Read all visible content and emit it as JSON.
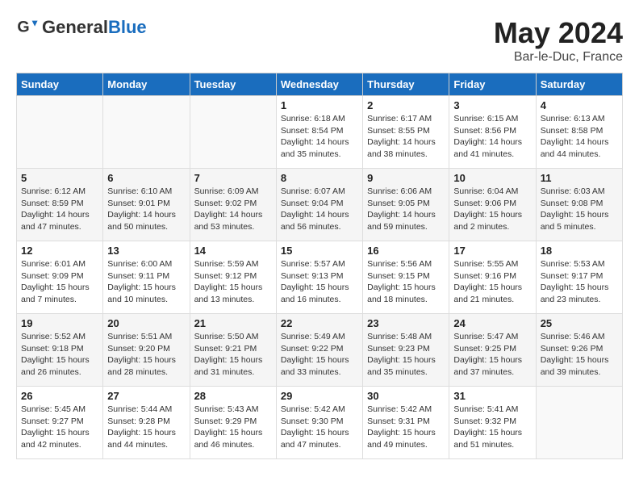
{
  "header": {
    "logo_general": "General",
    "logo_blue": "Blue",
    "month": "May 2024",
    "location": "Bar-le-Duc, France"
  },
  "days_of_week": [
    "Sunday",
    "Monday",
    "Tuesday",
    "Wednesday",
    "Thursday",
    "Friday",
    "Saturday"
  ],
  "weeks": [
    [
      {
        "day": "",
        "sunrise": "",
        "sunset": "",
        "daylight": ""
      },
      {
        "day": "",
        "sunrise": "",
        "sunset": "",
        "daylight": ""
      },
      {
        "day": "",
        "sunrise": "",
        "sunset": "",
        "daylight": ""
      },
      {
        "day": "1",
        "sunrise": "Sunrise: 6:18 AM",
        "sunset": "Sunset: 8:54 PM",
        "daylight": "Daylight: 14 hours and 35 minutes."
      },
      {
        "day": "2",
        "sunrise": "Sunrise: 6:17 AM",
        "sunset": "Sunset: 8:55 PM",
        "daylight": "Daylight: 14 hours and 38 minutes."
      },
      {
        "day": "3",
        "sunrise": "Sunrise: 6:15 AM",
        "sunset": "Sunset: 8:56 PM",
        "daylight": "Daylight: 14 hours and 41 minutes."
      },
      {
        "day": "4",
        "sunrise": "Sunrise: 6:13 AM",
        "sunset": "Sunset: 8:58 PM",
        "daylight": "Daylight: 14 hours and 44 minutes."
      }
    ],
    [
      {
        "day": "5",
        "sunrise": "Sunrise: 6:12 AM",
        "sunset": "Sunset: 8:59 PM",
        "daylight": "Daylight: 14 hours and 47 minutes."
      },
      {
        "day": "6",
        "sunrise": "Sunrise: 6:10 AM",
        "sunset": "Sunset: 9:01 PM",
        "daylight": "Daylight: 14 hours and 50 minutes."
      },
      {
        "day": "7",
        "sunrise": "Sunrise: 6:09 AM",
        "sunset": "Sunset: 9:02 PM",
        "daylight": "Daylight: 14 hours and 53 minutes."
      },
      {
        "day": "8",
        "sunrise": "Sunrise: 6:07 AM",
        "sunset": "Sunset: 9:04 PM",
        "daylight": "Daylight: 14 hours and 56 minutes."
      },
      {
        "day": "9",
        "sunrise": "Sunrise: 6:06 AM",
        "sunset": "Sunset: 9:05 PM",
        "daylight": "Daylight: 14 hours and 59 minutes."
      },
      {
        "day": "10",
        "sunrise": "Sunrise: 6:04 AM",
        "sunset": "Sunset: 9:06 PM",
        "daylight": "Daylight: 15 hours and 2 minutes."
      },
      {
        "day": "11",
        "sunrise": "Sunrise: 6:03 AM",
        "sunset": "Sunset: 9:08 PM",
        "daylight": "Daylight: 15 hours and 5 minutes."
      }
    ],
    [
      {
        "day": "12",
        "sunrise": "Sunrise: 6:01 AM",
        "sunset": "Sunset: 9:09 PM",
        "daylight": "Daylight: 15 hours and 7 minutes."
      },
      {
        "day": "13",
        "sunrise": "Sunrise: 6:00 AM",
        "sunset": "Sunset: 9:11 PM",
        "daylight": "Daylight: 15 hours and 10 minutes."
      },
      {
        "day": "14",
        "sunrise": "Sunrise: 5:59 AM",
        "sunset": "Sunset: 9:12 PM",
        "daylight": "Daylight: 15 hours and 13 minutes."
      },
      {
        "day": "15",
        "sunrise": "Sunrise: 5:57 AM",
        "sunset": "Sunset: 9:13 PM",
        "daylight": "Daylight: 15 hours and 16 minutes."
      },
      {
        "day": "16",
        "sunrise": "Sunrise: 5:56 AM",
        "sunset": "Sunset: 9:15 PM",
        "daylight": "Daylight: 15 hours and 18 minutes."
      },
      {
        "day": "17",
        "sunrise": "Sunrise: 5:55 AM",
        "sunset": "Sunset: 9:16 PM",
        "daylight": "Daylight: 15 hours and 21 minutes."
      },
      {
        "day": "18",
        "sunrise": "Sunrise: 5:53 AM",
        "sunset": "Sunset: 9:17 PM",
        "daylight": "Daylight: 15 hours and 23 minutes."
      }
    ],
    [
      {
        "day": "19",
        "sunrise": "Sunrise: 5:52 AM",
        "sunset": "Sunset: 9:18 PM",
        "daylight": "Daylight: 15 hours and 26 minutes."
      },
      {
        "day": "20",
        "sunrise": "Sunrise: 5:51 AM",
        "sunset": "Sunset: 9:20 PM",
        "daylight": "Daylight: 15 hours and 28 minutes."
      },
      {
        "day": "21",
        "sunrise": "Sunrise: 5:50 AM",
        "sunset": "Sunset: 9:21 PM",
        "daylight": "Daylight: 15 hours and 31 minutes."
      },
      {
        "day": "22",
        "sunrise": "Sunrise: 5:49 AM",
        "sunset": "Sunset: 9:22 PM",
        "daylight": "Daylight: 15 hours and 33 minutes."
      },
      {
        "day": "23",
        "sunrise": "Sunrise: 5:48 AM",
        "sunset": "Sunset: 9:23 PM",
        "daylight": "Daylight: 15 hours and 35 minutes."
      },
      {
        "day": "24",
        "sunrise": "Sunrise: 5:47 AM",
        "sunset": "Sunset: 9:25 PM",
        "daylight": "Daylight: 15 hours and 37 minutes."
      },
      {
        "day": "25",
        "sunrise": "Sunrise: 5:46 AM",
        "sunset": "Sunset: 9:26 PM",
        "daylight": "Daylight: 15 hours and 39 minutes."
      }
    ],
    [
      {
        "day": "26",
        "sunrise": "Sunrise: 5:45 AM",
        "sunset": "Sunset: 9:27 PM",
        "daylight": "Daylight: 15 hours and 42 minutes."
      },
      {
        "day": "27",
        "sunrise": "Sunrise: 5:44 AM",
        "sunset": "Sunset: 9:28 PM",
        "daylight": "Daylight: 15 hours and 44 minutes."
      },
      {
        "day": "28",
        "sunrise": "Sunrise: 5:43 AM",
        "sunset": "Sunset: 9:29 PM",
        "daylight": "Daylight: 15 hours and 46 minutes."
      },
      {
        "day": "29",
        "sunrise": "Sunrise: 5:42 AM",
        "sunset": "Sunset: 9:30 PM",
        "daylight": "Daylight: 15 hours and 47 minutes."
      },
      {
        "day": "30",
        "sunrise": "Sunrise: 5:42 AM",
        "sunset": "Sunset: 9:31 PM",
        "daylight": "Daylight: 15 hours and 49 minutes."
      },
      {
        "day": "31",
        "sunrise": "Sunrise: 5:41 AM",
        "sunset": "Sunset: 9:32 PM",
        "daylight": "Daylight: 15 hours and 51 minutes."
      },
      {
        "day": "",
        "sunrise": "",
        "sunset": "",
        "daylight": ""
      }
    ]
  ]
}
